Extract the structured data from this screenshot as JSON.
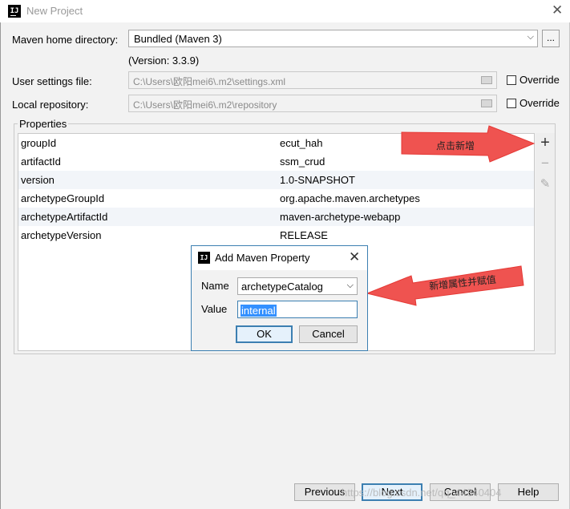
{
  "window": {
    "title": "New Project",
    "icon": "intellij-icon",
    "close_glyph": "✕"
  },
  "maven_home": {
    "label": "Maven home directory:",
    "value": "Bundled (Maven 3)",
    "version": "(Version: 3.3.9)",
    "browse_label": "..."
  },
  "user_settings": {
    "label": "User settings file:",
    "value": "C:\\Users\\欧阳mei6\\.m2\\settings.xml",
    "override_label": "Override"
  },
  "local_repo": {
    "label": "Local repository:",
    "value": "C:\\Users\\欧阳mei6\\.m2\\repository",
    "override_label": "Override"
  },
  "properties": {
    "title": "Properties",
    "rows": [
      {
        "key": "groupId",
        "value": "ecut_hah"
      },
      {
        "key": "artifactId",
        "value": "ssm_crud"
      },
      {
        "key": "version",
        "value": "1.0-SNAPSHOT"
      },
      {
        "key": "archetypeGroupId",
        "value": "org.apache.maven.archetypes"
      },
      {
        "key": "archetypeArtifactId",
        "value": "maven-archetype-webapp"
      },
      {
        "key": "archetypeVersion",
        "value": "RELEASE"
      }
    ],
    "tools": {
      "add": "+",
      "remove": "−",
      "edit": "✎"
    }
  },
  "annotations": {
    "add_note": "点击新增",
    "dialog_note": "新增属性并赋值",
    "arrow_color": "#ef5350"
  },
  "dialog": {
    "title": "Add Maven Property",
    "name_label": "Name",
    "name_value": "archetypeCatalog",
    "value_label": "Value",
    "value_value": "internal",
    "ok_label": "OK",
    "cancel_label": "Cancel"
  },
  "footer": {
    "previous": "Previous",
    "next": "Next",
    "cancel": "Cancel",
    "help": "Help"
  },
  "watermark": "https://blog.csdn.net/qq_44340404"
}
